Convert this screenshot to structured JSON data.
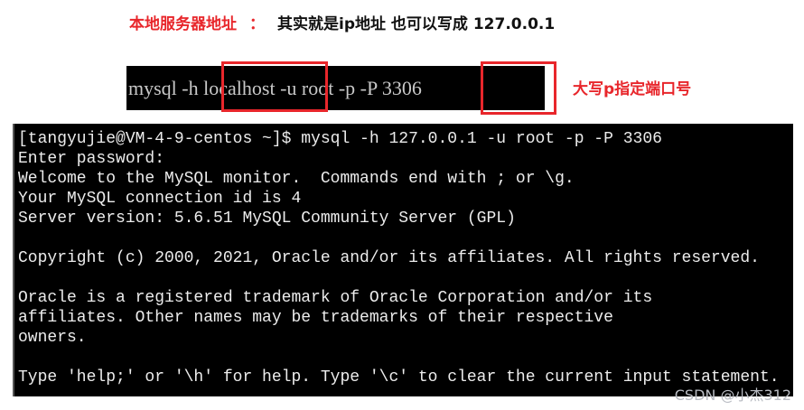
{
  "annotation_top": {
    "label": "本地服务器地址",
    "colon": "：",
    "text": "其实就是ip地址 也可以写成  127.0.0.1"
  },
  "command_snippet": {
    "prefix": "mysql -h ",
    "host": "localhost",
    "middle": " -u root -p -P ",
    "port": "3306"
  },
  "annotation_port": {
    "text": "大写p指定端口号"
  },
  "terminal": {
    "lines": [
      "[tangyujie@VM-4-9-centos ~]$ mysql -h 127.0.0.1 -u root -p -P 3306",
      "Enter password:",
      "Welcome to the MySQL monitor.  Commands end with ; or \\g.",
      "Your MySQL connection id is 4",
      "Server version: 5.6.51 MySQL Community Server (GPL)",
      "",
      "Copyright (c) 2000, 2021, Oracle and/or its affiliates. All rights reserved.",
      "",
      "Oracle is a registered trademark of Oracle Corporation and/or its",
      "affiliates. Other names may be trademarks of their respective",
      "owners.",
      "",
      "Type 'help;' or '\\h' for help. Type '\\c' to clear the current input statement."
    ]
  },
  "watermark": {
    "text": "CSDN @小杰312"
  },
  "colors": {
    "annotation_red": "#e8262b",
    "terminal_bg": "#000000",
    "terminal_fg": "#ececec"
  }
}
